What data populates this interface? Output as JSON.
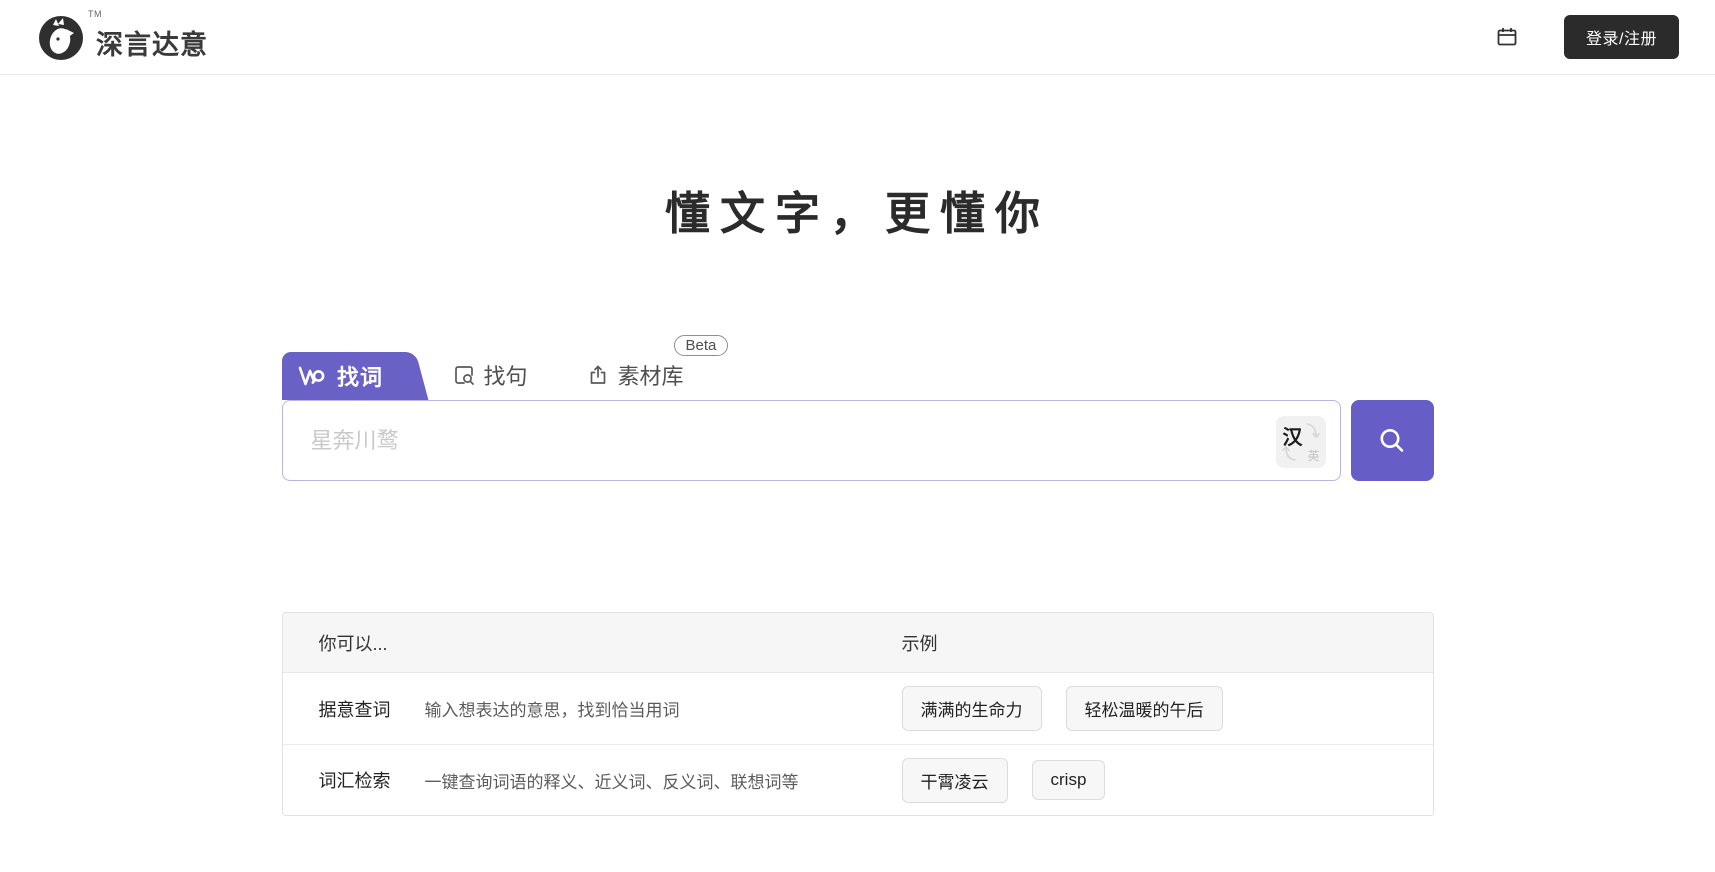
{
  "header": {
    "brand": "深言达意",
    "tm": "TM",
    "login_label": "登录/注册"
  },
  "hero": {
    "title": "懂文字，更懂你"
  },
  "tabs": [
    {
      "label": "找词",
      "active": true
    },
    {
      "label": "找句",
      "active": false
    },
    {
      "label": "素材库",
      "active": false,
      "badge": "Beta"
    }
  ],
  "search": {
    "placeholder": "星奔川鹜",
    "value": "",
    "lang_primary": "汉",
    "lang_secondary": "英"
  },
  "table": {
    "headers": [
      "你可以...",
      "示例"
    ],
    "rows": [
      {
        "term": "据意查词",
        "desc": "输入想表达的意思，找到恰当用词",
        "examples": [
          "满满的生命力",
          "轻松温暖的午后"
        ]
      },
      {
        "term": "词汇检索",
        "desc": "一键查询词语的释义、近义词、反义词、联想词等",
        "examples": [
          "干霄凌云",
          "crisp"
        ]
      }
    ]
  },
  "icons": {
    "logo": "whale-logo-icon",
    "calendar": "calendar-icon",
    "wantwords": "wantwords-w-icon",
    "sentence_search": "sentence-search-icon",
    "material_share": "share-box-icon",
    "magnifier": "search-icon",
    "lang_swap": "swap-arrows-icon"
  },
  "colors": {
    "accent_purple": "#6a61c6",
    "button_purple": "#665dc6",
    "dark_button": "#2b2b2b",
    "chip_bg": "#f7f7f8",
    "table_header_bg": "#f6f6f7",
    "border_light": "#e2e2e4",
    "placeholder_gray": "#c9c9c9"
  }
}
